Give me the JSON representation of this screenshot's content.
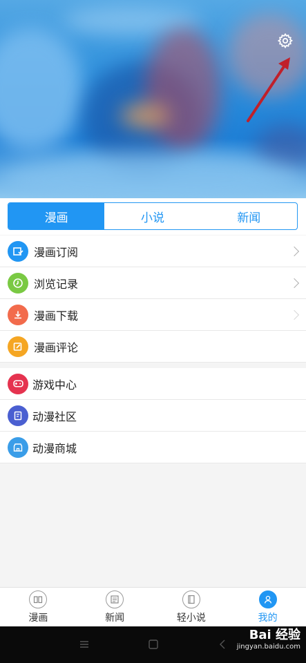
{
  "tabs": [
    {
      "label": "漫画",
      "active": true
    },
    {
      "label": "小说",
      "active": false
    },
    {
      "label": "新闻",
      "active": false
    }
  ],
  "menu_group_1": [
    {
      "label": "漫画订阅",
      "icon": "subscribe-icon",
      "color": "#2196f3",
      "chevron": true
    },
    {
      "label": "浏览记录",
      "icon": "clock-icon",
      "color": "#7ac943",
      "chevron": true
    },
    {
      "label": "漫画下载",
      "icon": "download-icon",
      "color": "#f26b4c",
      "chevron": true
    },
    {
      "label": "漫画评论",
      "icon": "comment-icon",
      "color": "#f5a623",
      "chevron": false
    }
  ],
  "menu_group_2": [
    {
      "label": "游戏中心",
      "icon": "gamepad-icon",
      "color": "#e5334f"
    },
    {
      "label": "动漫社区",
      "icon": "community-icon",
      "color": "#4a5fd1"
    },
    {
      "label": "动漫商城",
      "icon": "shop-icon",
      "color": "#3a9de8"
    }
  ],
  "bottom_nav": [
    {
      "label": "漫画",
      "icon": "book-icon",
      "active": false
    },
    {
      "label": "新闻",
      "icon": "news-icon",
      "active": false
    },
    {
      "label": "轻小说",
      "icon": "novel-icon",
      "active": false
    },
    {
      "label": "我的",
      "icon": "profile-icon",
      "active": true
    }
  ],
  "watermark": {
    "logo": "Bai 经验",
    "url": "jingyan.baidu.com"
  },
  "colors": {
    "accent": "#2196f3",
    "arrow": "#c0202a"
  }
}
